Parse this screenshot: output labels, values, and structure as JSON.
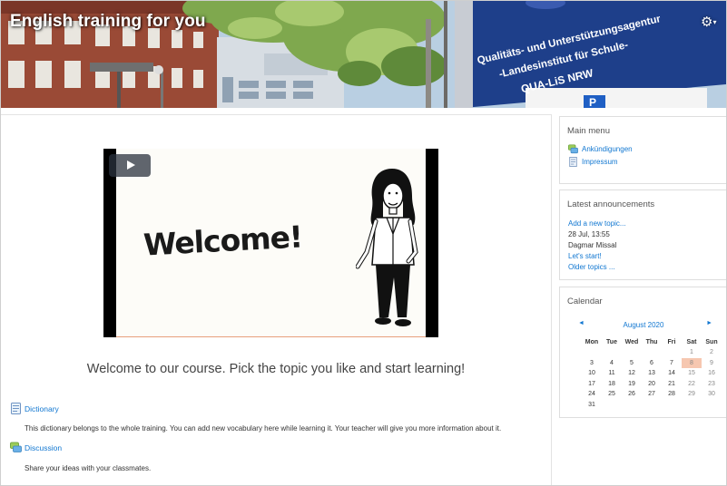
{
  "header": {
    "course_title": "English training for you",
    "settings_icon": "gear-icon",
    "settings_caret": "▾",
    "sign_text": {
      "line1": "Qualitäts- und Unterstützungsagentur",
      "line2": "-Landesinstitut für Schule-",
      "line3": "QUA-LiS NRW",
      "parking": "P"
    }
  },
  "video": {
    "welcome_text": "Welcome!",
    "play_icon": "play-icon"
  },
  "main": {
    "intro": "Welcome to our course. Pick the topic you like and start learning!",
    "activities": [
      {
        "name": "Dictionary",
        "icon": "glossary-icon",
        "description": "This dictionary belongs to the whole training. You can add new vocabulary here while learning it. Your teacher will give you more information about it."
      },
      {
        "name": "Discussion",
        "icon": "forum-icon",
        "description": "Share your ideas with your classmates."
      }
    ]
  },
  "blocks": {
    "main_menu": {
      "title": "Main menu",
      "items": [
        {
          "label": "Ankündigungen",
          "icon": "forum-icon"
        },
        {
          "label": "Impressum",
          "icon": "page-icon"
        }
      ]
    },
    "announcements": {
      "title": "Latest announcements",
      "add_topic": "Add a new topic...",
      "date": "28 Jul, 13:55",
      "author": "Dagmar Missal",
      "post_title": "Let's start!",
      "older": "Older topics ..."
    },
    "calendar": {
      "title": "Calendar",
      "month": "August 2020",
      "prev": "◄",
      "next": "►",
      "weekdays": [
        "Mon",
        "Tue",
        "Wed",
        "Thu",
        "Fri",
        "Sat",
        "Sun"
      ],
      "weeks": [
        [
          "",
          "",
          "",
          "",
          "",
          "1",
          "2"
        ],
        [
          "3",
          "4",
          "5",
          "6",
          "7",
          "8",
          "9"
        ],
        [
          "10",
          "11",
          "12",
          "13",
          "14",
          "15",
          "16"
        ],
        [
          "17",
          "18",
          "19",
          "20",
          "21",
          "22",
          "23"
        ],
        [
          "24",
          "25",
          "26",
          "27",
          "28",
          "29",
          "30"
        ],
        [
          "31",
          "",
          "",
          "",
          "",
          "",
          ""
        ]
      ],
      "today": "8"
    }
  },
  "colors": {
    "link": "#1177d1",
    "today_highlight": "#f6c7b0"
  }
}
